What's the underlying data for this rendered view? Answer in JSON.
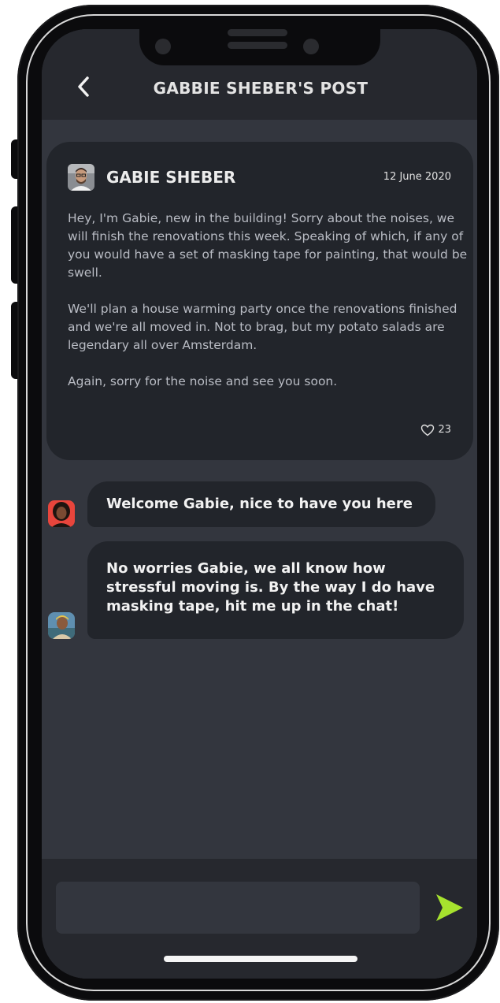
{
  "header": {
    "title": "GABBIE SHEBER'S POST",
    "back_icon": "chevron-left-icon"
  },
  "post": {
    "author": "GABIE SHEBER",
    "date": "12 June 2020",
    "paragraphs": [
      "Hey, I'm Gabie, new in the building! Sorry about the noises, we will finish the renovations this week. Speaking of which, if any of you would have a set of masking tape for painting, that would be swell.",
      "We'll plan a house warming party once the renovations finished and we're all moved in. Not to brag, but my potato salads are legendary all over Amsterdam.",
      "Again, sorry for the noise and see you soon."
    ],
    "likes": "23",
    "like_icon": "heart-icon"
  },
  "comments": [
    {
      "text": "Welcome Gabie, nice to have you here"
    },
    {
      "text": "No worries Gabie, we all know how stressful moving is. By the way I do have masking tape, hit me up in the chat!"
    }
  ],
  "composer": {
    "value": "",
    "placeholder": "",
    "send_icon": "send-arrow-icon",
    "send_color": "#a6e22e"
  }
}
